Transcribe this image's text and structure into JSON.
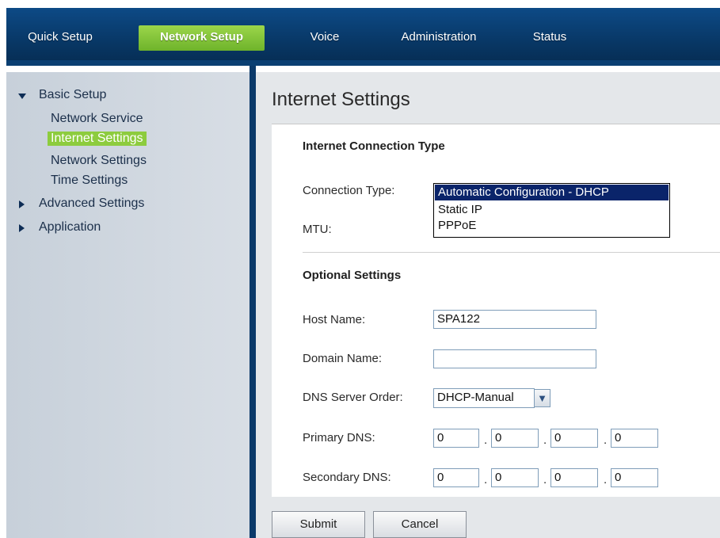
{
  "topnav": {
    "tabs": [
      {
        "label": "Quick Setup"
      },
      {
        "label": "Network Setup",
        "active": true
      },
      {
        "label": "Voice"
      },
      {
        "label": "Administration"
      },
      {
        "label": "Status"
      }
    ]
  },
  "sidebar": {
    "groups": [
      {
        "label": "Basic Setup",
        "expanded": true,
        "items": [
          "Network Service",
          "Internet Settings",
          "Network Settings",
          "Time Settings"
        ],
        "active_item": "Internet Settings"
      },
      {
        "label": "Advanced Settings",
        "expanded": false
      },
      {
        "label": "Application",
        "expanded": false
      }
    ]
  },
  "page": {
    "title": "Internet Settings",
    "connection_section": "Internet Connection Type",
    "connection_type_label": "Connection Type:",
    "connection_options": [
      "Automatic Configuration - DHCP",
      "Static IP",
      "PPPoE"
    ],
    "connection_selected": "Automatic Configuration - DHCP",
    "mtu_label": "MTU:",
    "optional_section": "Optional Settings",
    "host_name_label": "Host Name:",
    "host_name_value": "SPA122",
    "domain_name_label": "Domain Name:",
    "domain_name_value": "",
    "dns_order_label": "DNS Server Order:",
    "dns_order_value": "DHCP-Manual",
    "primary_dns_label": "Primary DNS:",
    "primary_dns": [
      "0",
      "0",
      "0",
      "0"
    ],
    "secondary_dns_label": "Secondary DNS:",
    "secondary_dns": [
      "0",
      "0",
      "0",
      "0"
    ],
    "submit_label": "Submit",
    "cancel_label": "Cancel"
  },
  "colors": {
    "nav_blue": "#083765",
    "active_green": "#7dc236",
    "selection_navy": "#0a246a"
  }
}
